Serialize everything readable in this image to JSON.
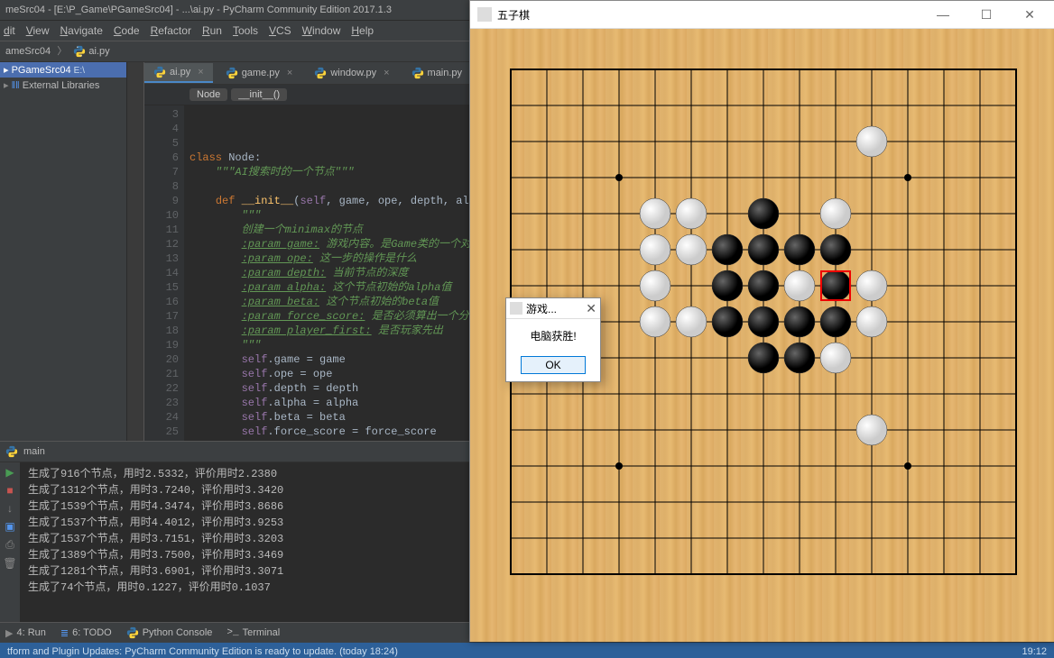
{
  "title_bar": "meSrc04 - [E:\\P_Game\\PGameSrc04] - ...\\ai.py - PyCharm Community Edition 2017.1.3",
  "menu": [
    "dit",
    "View",
    "Navigate",
    "Code",
    "Refactor",
    "Run",
    "Tools",
    "VCS",
    "Window",
    "Help"
  ],
  "breadcrumb": {
    "root": "ameSrc04",
    "file": "ai.py"
  },
  "sidebar": {
    "project": "PGameSrc04",
    "project_path": "E:\\",
    "external": "External Libraries"
  },
  "tabs": [
    {
      "label": "ai.py",
      "active": true
    },
    {
      "label": "game.py",
      "active": false
    },
    {
      "label": "window.py",
      "active": false
    },
    {
      "label": "main.py",
      "active": false
    }
  ],
  "sub_bar": {
    "class": "Node",
    "method": "__init__()"
  },
  "line_start": 3,
  "code_lines": [
    "",
    "",
    "",
    "class Node:",
    "    \"\"\"AI搜索时的一个节点\"\"\"",
    "",
    "    def __init__(self, game, ope, depth, alpha,",
    "        \"\"\"",
    "        创建一个minimax的节点",
    "        :param game: 游戏内容。是Game类的一个对象",
    "        :param ope: 这一步的操作是什么",
    "        :param depth: 当前节点的深度",
    "        :param alpha: 这个节点初始的alpha值",
    "        :param beta: 这个节点初始的beta值",
    "        :param force_score: 是否必须算出一个分数",
    "        :param player_first: 是否玩家先出",
    "        \"\"\"",
    "        self.game = game",
    "        self.ope = ope",
    "        self.depth = depth",
    "        self.alpha = alpha",
    "        self.beta = beta",
    "        self.force_score = force_score"
  ],
  "run": {
    "label": "main",
    "lines": [
      "生成了916个节点，用时2.5332，评价用时2.2380",
      "生成了1312个节点，用时3.7240，评价用时3.3420",
      "生成了1539个节点，用时4.3474，评价用时3.8686",
      "生成了1537个节点，用时4.4012，评价用时3.9253",
      "生成了1537个节点，用时3.7151，评价用时3.3203",
      "生成了1389个节点，用时3.7500，评价用时3.3469",
      "生成了1281个节点，用时3.6901，评价用时3.3071",
      "生成了74个节点，用时0.1227，评价用时0.1037"
    ]
  },
  "bottom_tabs": {
    "run": "4: Run",
    "todo": "6: TODO",
    "pyconsole": "Python Console",
    "terminal": "Terminal"
  },
  "status": {
    "msg": "tform and Plugin Updates: PyCharm Community Edition is ready to update. (today 18:24)",
    "time": "19:12"
  },
  "gomoku": {
    "title": "五子棋",
    "board_size": 15,
    "cell": 40,
    "offset": 45,
    "stars": [
      [
        3,
        3
      ],
      [
        3,
        11
      ],
      [
        11,
        3
      ],
      [
        11,
        11
      ],
      [
        7,
        7
      ]
    ],
    "stones": {
      "black": [
        [
          4,
          7
        ],
        [
          5,
          6
        ],
        [
          5,
          7
        ],
        [
          5,
          8
        ],
        [
          5,
          9
        ],
        [
          6,
          6
        ],
        [
          6,
          7
        ],
        [
          6,
          9
        ],
        [
          7,
          6
        ],
        [
          7,
          7
        ],
        [
          7,
          8
        ],
        [
          7,
          9
        ],
        [
          8,
          7
        ],
        [
          8,
          8
        ]
      ],
      "white": [
        [
          2,
          10
        ],
        [
          4,
          4
        ],
        [
          4,
          5
        ],
        [
          4,
          9
        ],
        [
          5,
          4
        ],
        [
          5,
          5
        ],
        [
          6,
          4
        ],
        [
          6,
          8
        ],
        [
          6,
          10
        ],
        [
          7,
          4
        ],
        [
          7,
          5
        ],
        [
          7,
          10
        ],
        [
          8,
          9
        ],
        [
          10,
          10
        ]
      ]
    },
    "last_move": [
      6,
      9
    ]
  },
  "dialog": {
    "title": "游戏...",
    "body": "电脑获胜!",
    "ok": "OK"
  }
}
